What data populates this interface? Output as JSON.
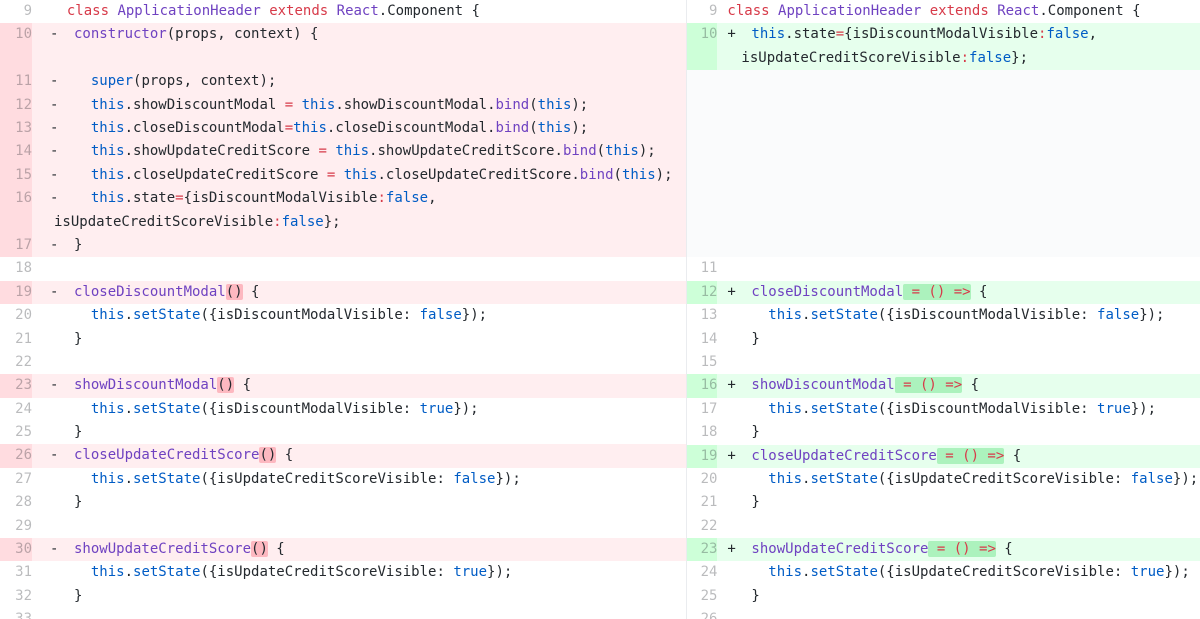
{
  "left": {
    "lines": [
      {
        "n": "9",
        "type": "ctx"
      },
      {
        "n": "10",
        "type": "del"
      },
      {
        "n": "11",
        "type": "del"
      },
      {
        "n": "12",
        "type": "del"
      },
      {
        "n": "13",
        "type": "del"
      },
      {
        "n": "14",
        "type": "del"
      },
      {
        "n": "15",
        "type": "del"
      },
      {
        "n": "16",
        "type": "del"
      },
      {
        "n": "17",
        "type": "del"
      },
      {
        "n": "18",
        "type": "ctx"
      },
      {
        "n": "19",
        "type": "del"
      },
      {
        "n": "20",
        "type": "ctx"
      },
      {
        "n": "21",
        "type": "ctx"
      },
      {
        "n": "22",
        "type": "ctx"
      },
      {
        "n": "23",
        "type": "del"
      },
      {
        "n": "24",
        "type": "ctx"
      },
      {
        "n": "25",
        "type": "ctx"
      },
      {
        "n": "26",
        "type": "del"
      },
      {
        "n": "27",
        "type": "ctx"
      },
      {
        "n": "28",
        "type": "ctx"
      },
      {
        "n": "29",
        "type": "ctx"
      },
      {
        "n": "30",
        "type": "del"
      },
      {
        "n": "31",
        "type": "ctx"
      },
      {
        "n": "32",
        "type": "ctx"
      },
      {
        "n": "33",
        "type": "ctx"
      }
    ]
  },
  "right": {
    "lines": [
      {
        "n": "9",
        "type": "ctx"
      },
      {
        "n": "10",
        "type": "add"
      },
      {
        "n": "11",
        "type": "ctx"
      },
      {
        "n": "12",
        "type": "add"
      },
      {
        "n": "13",
        "type": "ctx"
      },
      {
        "n": "14",
        "type": "ctx"
      },
      {
        "n": "15",
        "type": "ctx"
      },
      {
        "n": "16",
        "type": "add"
      },
      {
        "n": "17",
        "type": "ctx"
      },
      {
        "n": "18",
        "type": "ctx"
      },
      {
        "n": "19",
        "type": "add"
      },
      {
        "n": "20",
        "type": "ctx"
      },
      {
        "n": "21",
        "type": "ctx"
      },
      {
        "n": "22",
        "type": "ctx"
      },
      {
        "n": "23",
        "type": "add"
      },
      {
        "n": "24",
        "type": "ctx"
      },
      {
        "n": "25",
        "type": "ctx"
      },
      {
        "n": "26",
        "type": "ctx"
      }
    ]
  },
  "markers": {
    "del": "-",
    "add": "+"
  },
  "text": {
    "class_kw": "class",
    "class_name": "ApplicationHeader",
    "extends_kw": "extends",
    "react": "React",
    "component": ".Component {",
    "constructor": "constructor",
    "constructor_args": "(props, context) {",
    "super_call": "super",
    "super_args": "(props, context);",
    "this": "this",
    "bind": "bind",
    "showDiscountModal": "showDiscountModal",
    "closeDiscountModal": "closeDiscountModal",
    "showUpdateCreditScore": "showUpdateCreditScore",
    "closeUpdateCreditScore": "closeUpdateCreditScore",
    "state_line_a": ".state",
    "state_eq": "=",
    "state_open": "{isDiscountModalVisible",
    "colon": ":",
    "false": "false",
    "true": "true",
    "state_cont": "isUpdateCreditScoreVisible",
    "state_close": "};",
    "close_brace": "}",
    "parens": "()",
    "open_brace": " {",
    "arrow": " = () =>",
    "setState": "setState",
    "set_discount": "({isDiscountModalVisible: ",
    "set_credit": "({isUpdateCreditScoreVisible: ",
    "set_end": "});",
    "dot": ".",
    "bind_this_end": "(this);",
    "assign": " = ",
    "assign_nospace": "=",
    "bind_open": "(",
    "bind_close": ");"
  }
}
